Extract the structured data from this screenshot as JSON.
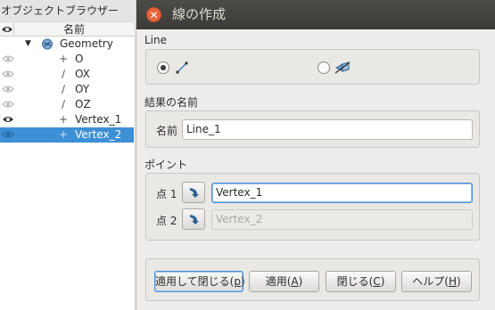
{
  "object_browser": {
    "title": "オブジェクトブラウザー",
    "column_name": "名前",
    "group": {
      "label": "Geometry",
      "icon": "geometry-icon",
      "expanded": true
    },
    "items": [
      {
        "label": "O",
        "kind": "vertex",
        "visible": false
      },
      {
        "label": "OX",
        "kind": "line",
        "visible": false
      },
      {
        "label": "OY",
        "kind": "line",
        "visible": false
      },
      {
        "label": "OZ",
        "kind": "line",
        "visible": false
      },
      {
        "label": "Vertex_1",
        "kind": "vertex",
        "visible": true
      },
      {
        "label": "Vertex_2",
        "kind": "vertex",
        "visible": false,
        "selected": true
      }
    ]
  },
  "dialog": {
    "title": "線の作成",
    "line_section": {
      "label": "Line",
      "options": [
        "two-points",
        "two-faces"
      ],
      "selected": "two-points"
    },
    "result_section": {
      "label": "結果の名前",
      "name_label": "名前",
      "name_value": "Line_1"
    },
    "points_section": {
      "label": "ポイント",
      "point1": {
        "label": "点 1",
        "value": "Vertex_1"
      },
      "point2": {
        "label": "点 2",
        "value": "Vertex_2"
      }
    },
    "buttons": {
      "apply_close_text": "適用して閉じる(",
      "apply_close_key": "p",
      "apply_close_end": ")",
      "apply_text": "適用(",
      "apply_key": "A",
      "apply_end": ")",
      "close_text": "閉じる(",
      "close_key": "C",
      "close_end": ")",
      "help_text": "ヘルプ(",
      "help_key": "H",
      "help_end": ")"
    }
  },
  "colors": {
    "selection": "#3d8fd6",
    "titlebar": "#3c3b37",
    "close": "#e9633a",
    "focus": "#4a90d9"
  }
}
